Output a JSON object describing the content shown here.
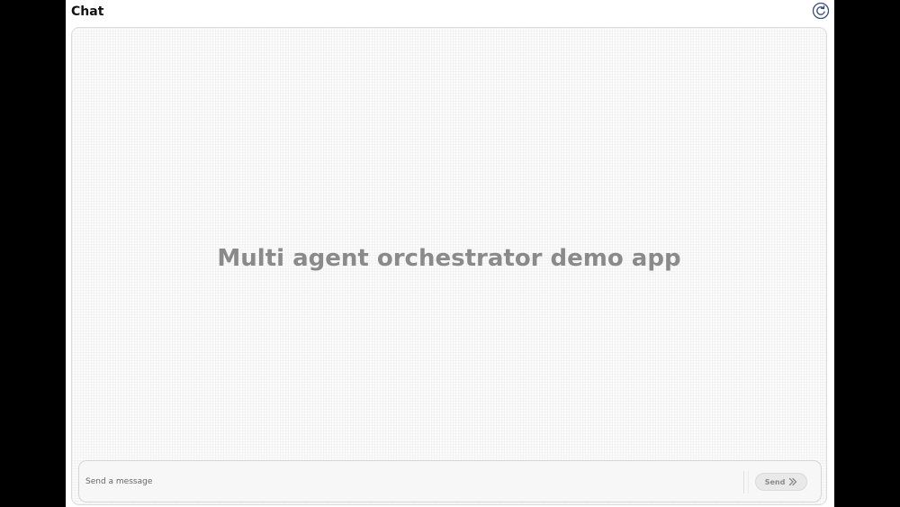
{
  "header": {
    "title": "Chat",
    "refresh_icon": "refresh-icon"
  },
  "main": {
    "welcome_text": "Multi agent orchestrator demo app"
  },
  "composer": {
    "placeholder": "Send a message",
    "value": "",
    "send_label": "Send",
    "send_icon": "double-chevron-right-icon"
  },
  "colors": {
    "outer_background": "#000000",
    "app_background": "#ffffff",
    "welcome_text": "#8a8a8a",
    "accent": "#3b4a8a"
  }
}
